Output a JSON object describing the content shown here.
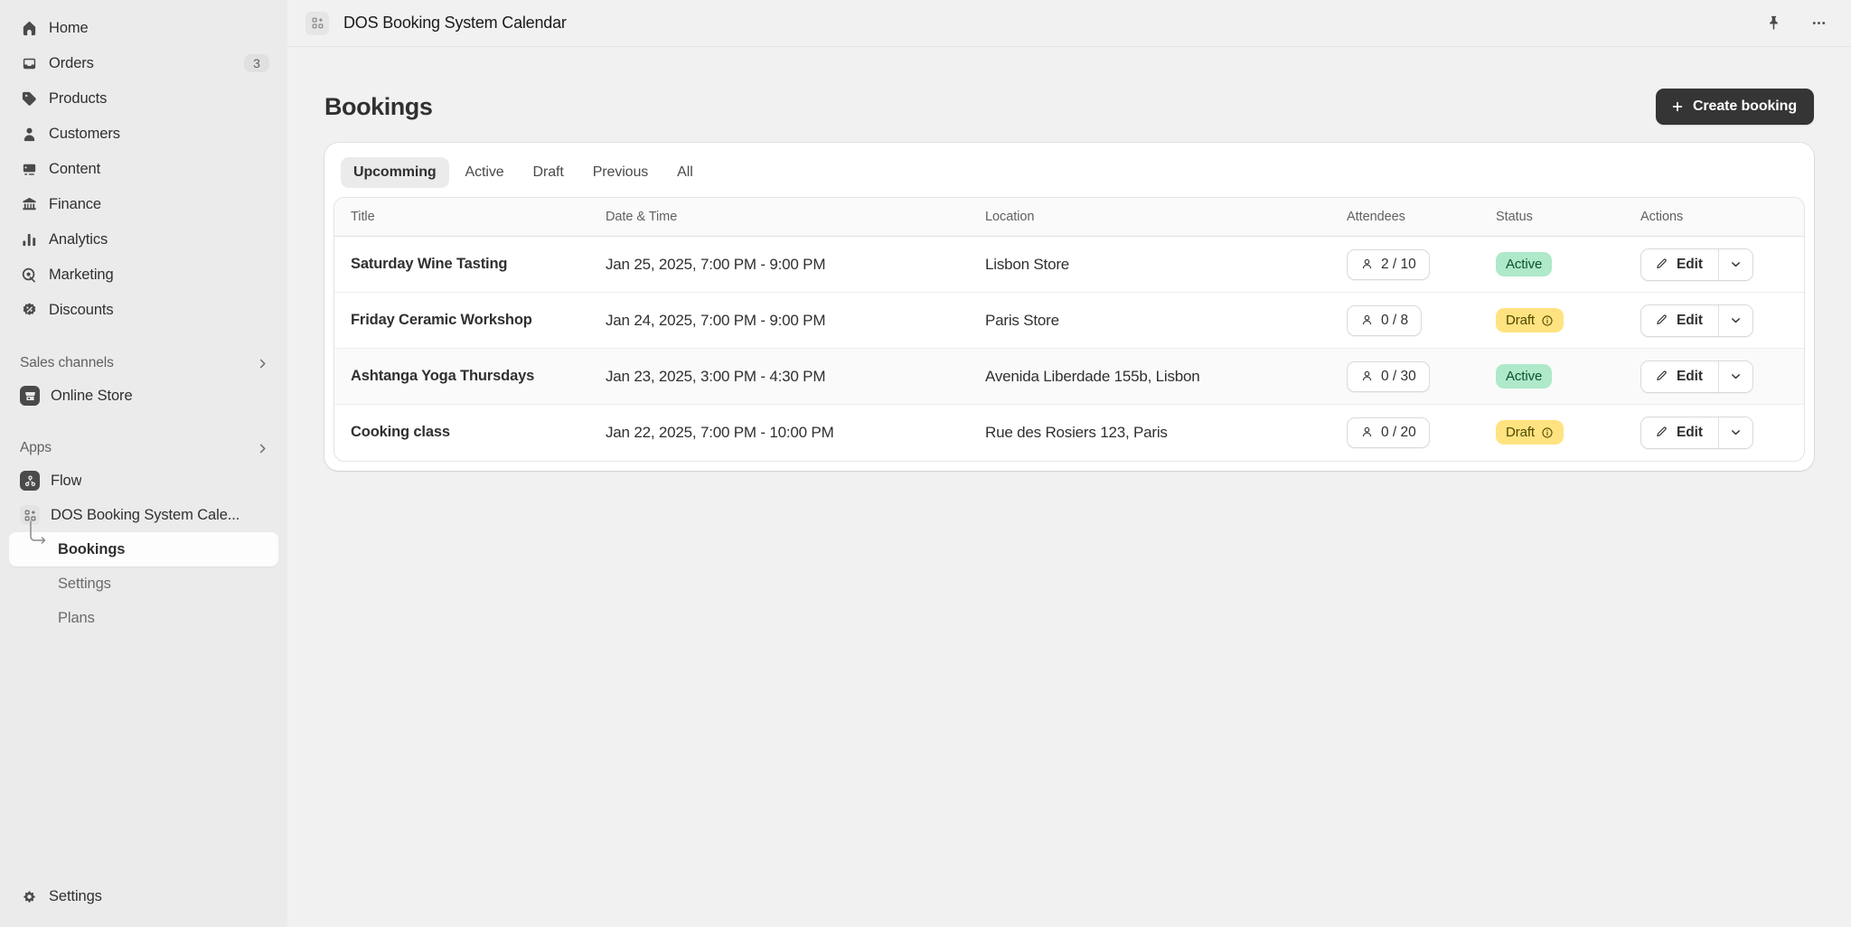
{
  "sidebar": {
    "nav": [
      {
        "label": "Home",
        "icon": "home-icon"
      },
      {
        "label": "Orders",
        "icon": "orders-icon",
        "badge": "3"
      },
      {
        "label": "Products",
        "icon": "products-icon"
      },
      {
        "label": "Customers",
        "icon": "customers-icon"
      },
      {
        "label": "Content",
        "icon": "content-icon"
      },
      {
        "label": "Finance",
        "icon": "finance-icon"
      },
      {
        "label": "Analytics",
        "icon": "analytics-icon"
      },
      {
        "label": "Marketing",
        "icon": "marketing-icon"
      },
      {
        "label": "Discounts",
        "icon": "discounts-icon"
      }
    ],
    "sales_channels": {
      "title": "Sales channels",
      "chevron": "chevron-right-icon",
      "items": [
        {
          "label": "Online Store",
          "icon": "online-store-icon"
        }
      ]
    },
    "apps": {
      "title": "Apps",
      "chevron": "chevron-right-icon",
      "items": [
        {
          "label": "Flow",
          "icon": "flow-icon"
        },
        {
          "label": "DOS Booking System Cale...",
          "icon": "app-grid-icon"
        }
      ],
      "sub_items": [
        {
          "label": "Bookings",
          "active": true
        },
        {
          "label": "Settings",
          "active": false
        },
        {
          "label": "Plans",
          "active": false
        }
      ]
    },
    "footer": {
      "label": "Settings",
      "icon": "gear-icon"
    }
  },
  "topbar": {
    "app_icon": "app-grid-icon",
    "title": "DOS Booking System Calendar",
    "pin_icon": "pin-icon",
    "more_icon": "ellipsis-icon"
  },
  "page": {
    "title": "Bookings",
    "create_button": {
      "label": "Create booking",
      "icon": "plus-icon"
    }
  },
  "tabs": [
    {
      "label": "Upcomming",
      "active": true
    },
    {
      "label": "Active",
      "active": false
    },
    {
      "label": "Draft",
      "active": false
    },
    {
      "label": "Previous",
      "active": false
    },
    {
      "label": "All",
      "active": false
    }
  ],
  "table": {
    "columns": [
      "Title",
      "Date & Time",
      "Location",
      "Attendees",
      "Status",
      "Actions"
    ],
    "rows": [
      {
        "title": "Saturday Wine Tasting",
        "datetime": "Jan 25, 2025, 7:00 PM - 9:00 PM",
        "location": "Lisbon Store",
        "attendees": "2 / 10",
        "status": "Active",
        "status_kind": "active",
        "status_info_icon": "",
        "edit_label": "Edit",
        "shaded": false
      },
      {
        "title": "Friday Ceramic Workshop",
        "datetime": "Jan 24, 2025, 7:00 PM - 9:00 PM",
        "location": "Paris Store",
        "attendees": "0 / 8",
        "status": "Draft",
        "status_kind": "draft",
        "status_info_icon": "info-icon",
        "edit_label": "Edit",
        "shaded": false
      },
      {
        "title": "Ashtanga Yoga Thursdays",
        "datetime": "Jan 23, 2025, 3:00 PM - 4:30 PM",
        "location": "Avenida Liberdade 155b, Lisbon",
        "attendees": "0 / 30",
        "status": "Active",
        "status_kind": "active",
        "status_info_icon": "",
        "edit_label": "Edit",
        "shaded": true
      },
      {
        "title": "Cooking class",
        "datetime": "Jan 22, 2025, 7:00 PM - 10:00 PM",
        "location": "Rue des Rosiers 123, Paris",
        "attendees": "0 / 20",
        "status": "Draft",
        "status_kind": "draft",
        "status_info_icon": "info-icon",
        "edit_label": "Edit",
        "shaded": false
      }
    ],
    "icons": {
      "attendee": "person-icon",
      "edit": "pencil-icon",
      "caret": "chevron-down-icon"
    }
  },
  "colors": {
    "sidebar_bg": "#ebebeb",
    "canvas_bg": "#f1f1f1",
    "card_bg": "#ffffff",
    "text_primary": "#303030",
    "text_secondary": "#616161",
    "primary_button": "#353535",
    "status_active_bg": "#aee9c9",
    "status_active_text": "#0c5132",
    "status_draft_bg": "#ffe380",
    "status_draft_text": "#4f4700"
  }
}
